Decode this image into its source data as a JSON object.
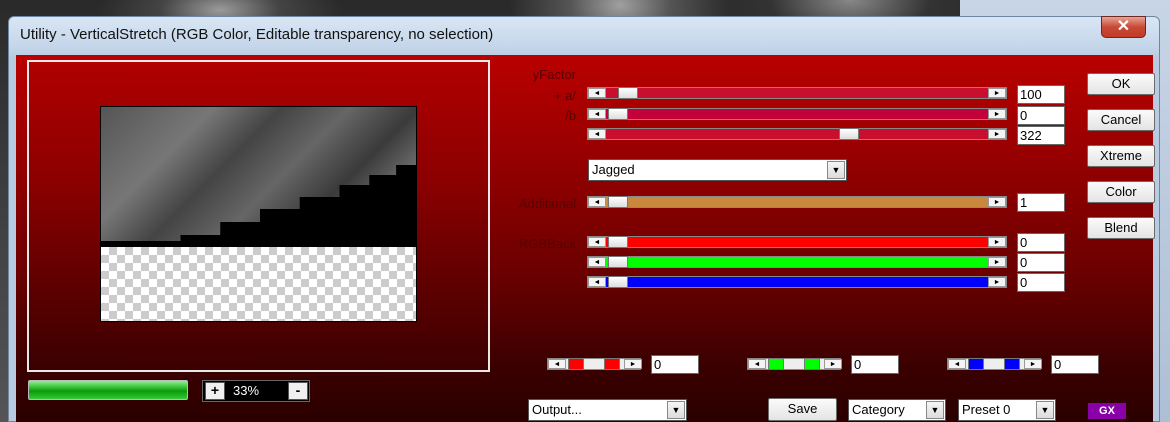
{
  "window": {
    "title": "Utility - VerticalStretch (RGB Color, Editable transparency, no selection)",
    "close_glyph": "✕"
  },
  "preview": {
    "zoom": "33%",
    "zoom_in": "+",
    "zoom_out": "-",
    "progress": 1.0
  },
  "params": {
    "yfactor": {
      "label": "yFactor",
      "value": "100"
    },
    "plus_a": {
      "label": "+ a/",
      "value": "0"
    },
    "div_b": {
      "label": "/b",
      "value": "322"
    },
    "mode": {
      "selected": "Jagged"
    },
    "additional": {
      "label": "Additional",
      "value": "1"
    },
    "rgbback": {
      "label": "RGBBack",
      "r": "0",
      "g": "0",
      "b": "0"
    }
  },
  "mini": {
    "red": "0",
    "green": "0",
    "blue": "0"
  },
  "buttons": {
    "ok": "OK",
    "cancel": "Cancel",
    "xtreme": "Xtreme",
    "color": "Color",
    "blend": "Blend",
    "save": "Save"
  },
  "bottom": {
    "output": "Output...",
    "category": "Category",
    "preset": "Preset 0"
  },
  "logo_text": "GX",
  "colors": {
    "track_yfactor": "#c8102e",
    "track_a": "#c2003a",
    "track_b": "#c8102e",
    "track_additional": "#c8893f",
    "track_r": "#ff0000",
    "track_g": "#00ff00",
    "track_b2": "#0000ff"
  }
}
